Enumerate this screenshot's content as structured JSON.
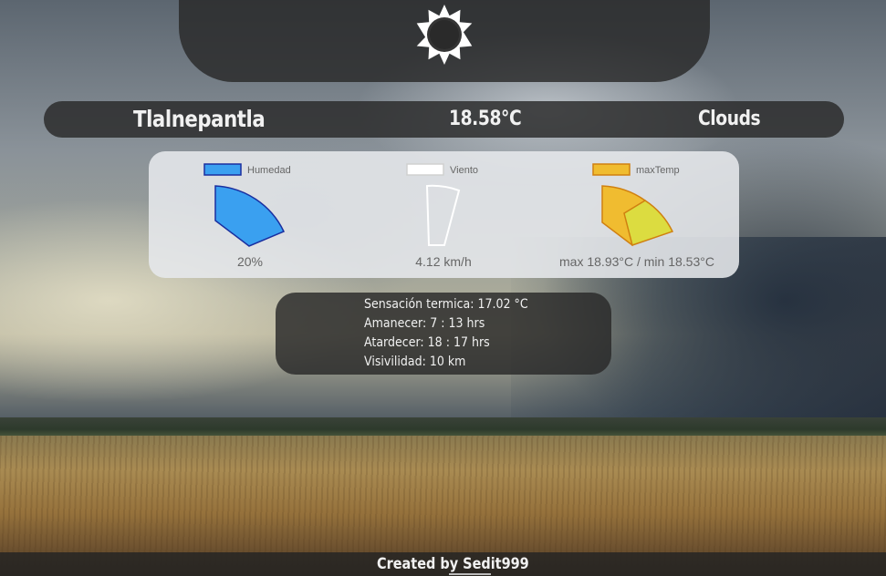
{
  "top_panel": {
    "icon": "sun-icon"
  },
  "info_bar": {
    "city": "Tlalnepantla",
    "temperature": "18.58°C",
    "condition": "Clouds"
  },
  "chart_data": {
    "type": "polar-area",
    "series": [
      {
        "name": "Humedad",
        "value": 20,
        "unit": "%",
        "caption": "20%",
        "color": "#3aa0f0",
        "border": "#1a2fa0"
      },
      {
        "name": "Viento",
        "value": 4.12,
        "unit": "km/h",
        "caption": "4.12 km/h",
        "color": "#ffffff",
        "border": "#dddddd"
      },
      {
        "name": "maxTemp",
        "values": {
          "max": 18.93,
          "min": 18.53
        },
        "unit": "°C",
        "caption": "max 18.93°C / min 18.53°C",
        "color": "#f0bc30",
        "secondary_color": "#dcdc40",
        "border": "#d08010"
      }
    ]
  },
  "details": {
    "sensacion": "Sensación termica: 17.02 °C",
    "amanecer": "Amanecer: 7 : 13 hrs",
    "atardecer": "Atardecer: 18 : 17 hrs",
    "visibilidad": "Visivilidad: 10 km"
  },
  "footer": {
    "credit": "Created by Sedit999"
  }
}
